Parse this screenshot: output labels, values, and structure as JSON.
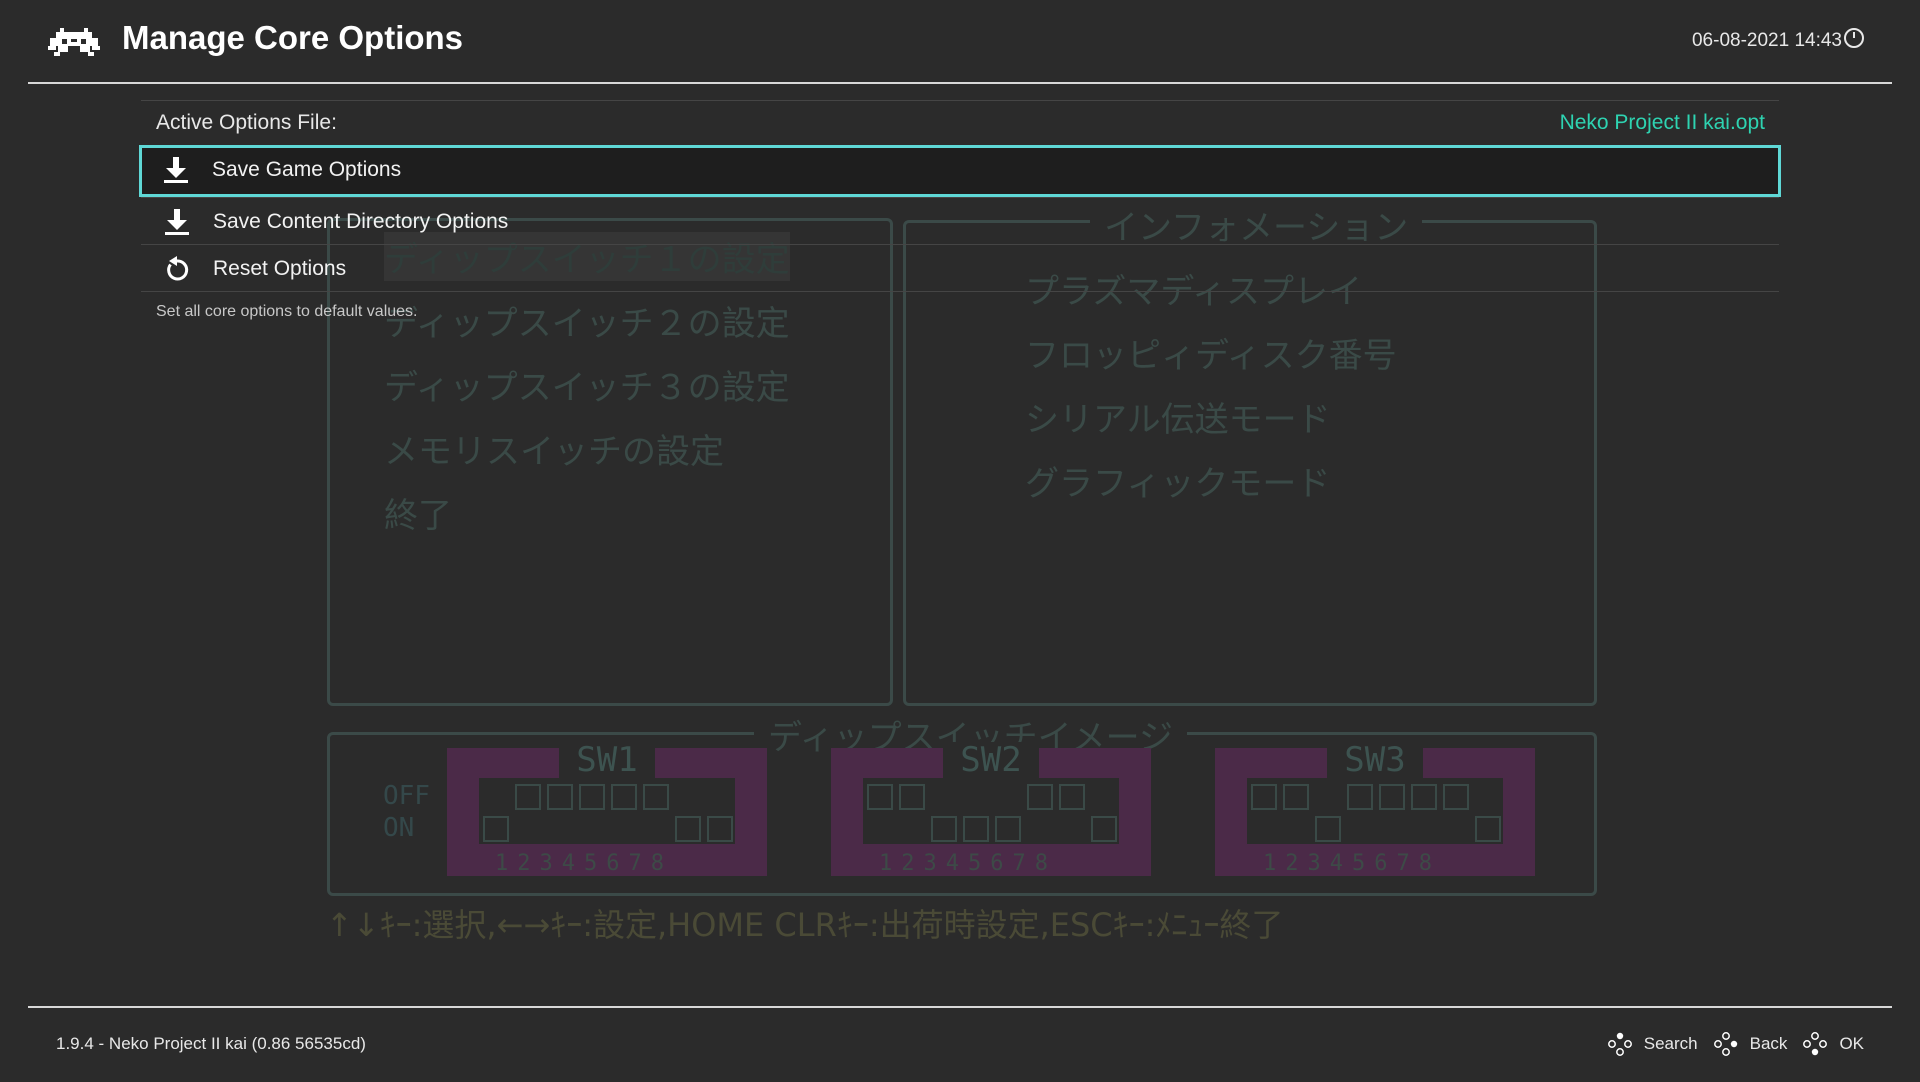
{
  "header": {
    "title": "Manage Core Options",
    "datetime": "06-08-2021 14:43"
  },
  "options_file": {
    "label": "Active Options File:",
    "value": "Neko Project II kai.opt"
  },
  "menu": {
    "items": [
      {
        "label": "Save Game Options",
        "icon": "download-icon",
        "selected": true
      },
      {
        "label": "Save Content Directory Options",
        "icon": "download-icon",
        "selected": false
      },
      {
        "label": "Reset Options",
        "icon": "reset-icon",
        "selected": false
      }
    ],
    "sublabel": "Set all core options to default values."
  },
  "footer": {
    "version": "1.9.4 - Neko Project II kai (0.86  56535cd)",
    "actions": [
      {
        "label": "Search",
        "icon": "gamepad-button-icon"
      },
      {
        "label": "Back",
        "icon": "gamepad-button-icon"
      },
      {
        "label": "OK",
        "icon": "gamepad-button-icon"
      }
    ]
  },
  "background": {
    "left_menu": [
      "ディップスイッチ１の設定",
      "ディップスイッチ２の設定",
      "ディップスイッチ３の設定",
      "メモリスイッチの設定",
      "終了"
    ],
    "info_title": "インフォメーション",
    "info_items": [
      "プラズマディスプレイ",
      "フロッピィディスク番号",
      "シリアル伝送モード",
      "グラフィックモード"
    ],
    "dip_title": "ディップスイッチイメージ",
    "off_label": "OFF",
    "on_label": "ON",
    "switches": [
      "SW1",
      "SW2",
      "SW3"
    ],
    "switch_numbers": "12345678",
    "help": "↑↓ｷｰ:選択,←→ｷｰ:設定,HOME CLRｷｰ:出荷時設定,ESCｷｰ:ﾒﾆｭｰ終了"
  },
  "colors": {
    "accent": "#2ed3b1",
    "selection_border": "#5fd8d6",
    "background": "#2b2b2b"
  }
}
